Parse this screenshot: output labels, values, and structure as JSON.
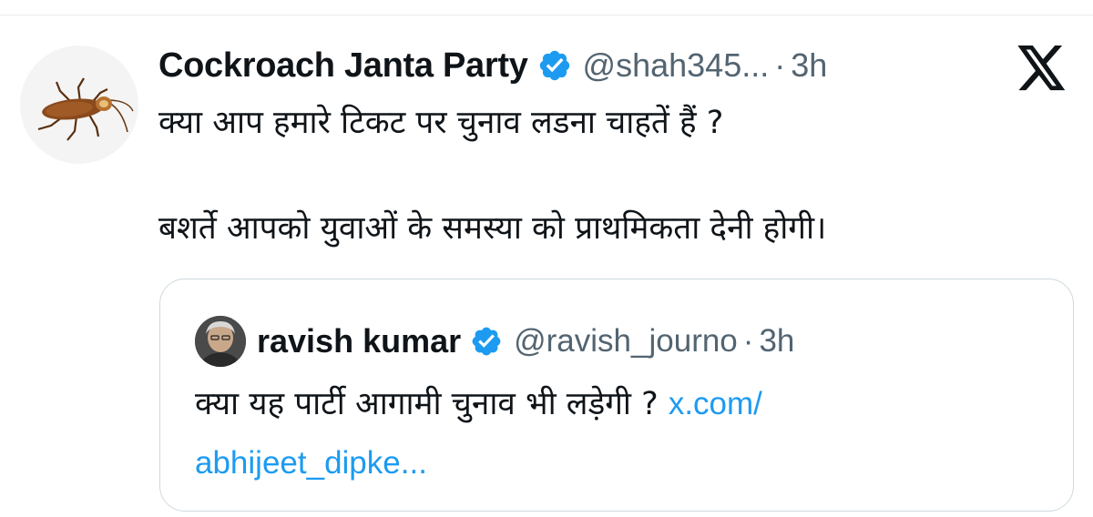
{
  "tweet": {
    "author": {
      "display_name": "Cockroach Janta Party",
      "handle": "@shah345...",
      "verified": true,
      "avatar_icon": "cockroach-avatar"
    },
    "separator": "·",
    "time": "3h",
    "lines": [
      "क्या आप हमारे टिकट पर चुनाव लडना चाहतें हैं ?",
      "बशर्ते आपको युवाओं के समस्या को प्राथमिकता देनी होगी।"
    ]
  },
  "quoted_tweet": {
    "author": {
      "display_name": "ravish kumar",
      "handle": "@ravish_journo",
      "verified": true,
      "avatar_icon": "user-avatar"
    },
    "separator": "·",
    "time": "3h",
    "text": "क्या यह पार्टी आगामी चुनाव भी लड़ेगी ?",
    "link_part1": "x.com/",
    "link_part2": "abhijeet_dipke..."
  },
  "platform_icon": "x-logo-icon",
  "colors": {
    "text_primary": "#0f1419",
    "text_secondary": "#536471",
    "link": "#1d9bf0",
    "verified_badge": "#1d9bf0",
    "card_border": "#cfd9de"
  }
}
